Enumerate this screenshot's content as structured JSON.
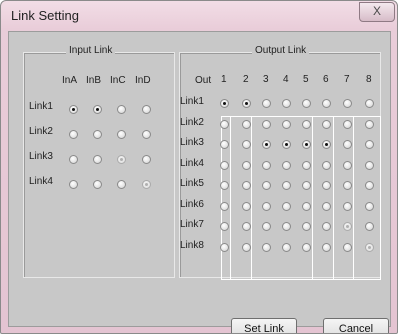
{
  "window": {
    "title": "Link Setting",
    "close_glyph": "X"
  },
  "input_link": {
    "legend": "Input Link",
    "columns": [
      "InA",
      "InB",
      "InC",
      "InD"
    ],
    "rows": [
      {
        "label": "Link1",
        "states": [
          "checked",
          "checked",
          "off",
          "off"
        ]
      },
      {
        "label": "Link2",
        "states": [
          "off",
          "off",
          "off",
          "off"
        ]
      },
      {
        "label": "Link3",
        "states": [
          "off",
          "off",
          "dim",
          "off"
        ]
      },
      {
        "label": "Link4",
        "states": [
          "off",
          "off",
          "off",
          "dim"
        ]
      }
    ]
  },
  "output_link": {
    "legend": "Output Link",
    "out_label": "Out",
    "columns": [
      "1",
      "2",
      "3",
      "4",
      "5",
      "6",
      "7",
      "8"
    ],
    "rows": [
      {
        "label": "Link1",
        "states": [
          "checked",
          "checked",
          "off",
          "off",
          "off",
          "off",
          "off",
          "off"
        ]
      },
      {
        "label": "Link2",
        "states": [
          "off",
          "off",
          "off",
          "off",
          "off",
          "off",
          "off",
          "off"
        ]
      },
      {
        "label": "Link3",
        "states": [
          "off",
          "off",
          "checked",
          "checked",
          "checked",
          "checked",
          "off",
          "off"
        ]
      },
      {
        "label": "Link4",
        "states": [
          "off",
          "off",
          "off",
          "off",
          "off",
          "off",
          "off",
          "off"
        ]
      },
      {
        "label": "Link5",
        "states": [
          "off",
          "off",
          "off",
          "off",
          "off",
          "off",
          "off",
          "off"
        ]
      },
      {
        "label": "Link6",
        "states": [
          "off",
          "off",
          "off",
          "off",
          "off",
          "off",
          "off",
          "off"
        ]
      },
      {
        "label": "Link7",
        "states": [
          "off",
          "off",
          "off",
          "off",
          "off",
          "off",
          "dim",
          "off"
        ]
      },
      {
        "label": "Link8",
        "states": [
          "off",
          "off",
          "off",
          "off",
          "off",
          "off",
          "off",
          "dim"
        ]
      }
    ]
  },
  "buttons": {
    "set_link": "Set Link",
    "cancel": "Cancel"
  }
}
